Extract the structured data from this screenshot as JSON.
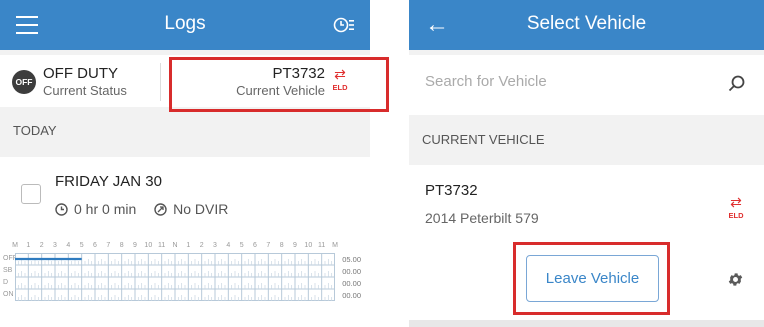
{
  "left": {
    "title": "Logs",
    "status": {
      "badge": "OFF",
      "main": "OFF DUTY",
      "sub": "Current Status"
    },
    "vehicle": {
      "id": "PT3732",
      "sub": "Current Vehicle",
      "eld": "ELD"
    },
    "section": "TODAY",
    "day": {
      "name": "FRIDAY",
      "date": "JAN 30",
      "hours": "0 hr 0 min",
      "dvir": "No DVIR"
    },
    "graph": {
      "hour_labels": [
        "M",
        "1",
        "2",
        "3",
        "4",
        "5",
        "6",
        "7",
        "8",
        "9",
        "10",
        "11",
        "N",
        "1",
        "2",
        "3",
        "4",
        "5",
        "6",
        "7",
        "8",
        "9",
        "10",
        "11",
        "M"
      ],
      "rows": [
        {
          "label": "OFF",
          "total": "05.00"
        },
        {
          "label": "SB",
          "total": "00.00"
        },
        {
          "label": "D",
          "total": "00.00"
        },
        {
          "label": "ON",
          "total": "00.00"
        }
      ],
      "off_duty_hours": 5
    }
  },
  "right": {
    "title": "Select Vehicle",
    "search_placeholder": "Search for Vehicle",
    "section": "CURRENT VEHICLE",
    "vehicle": {
      "id": "PT3732",
      "model": "2014 Peterbilt 579",
      "eld": "ELD"
    },
    "leave_button": "Leave Vehicle"
  },
  "colors": {
    "appbar": "#3a86c8",
    "highlight": "#d82c2c",
    "eld": "#e03030"
  }
}
